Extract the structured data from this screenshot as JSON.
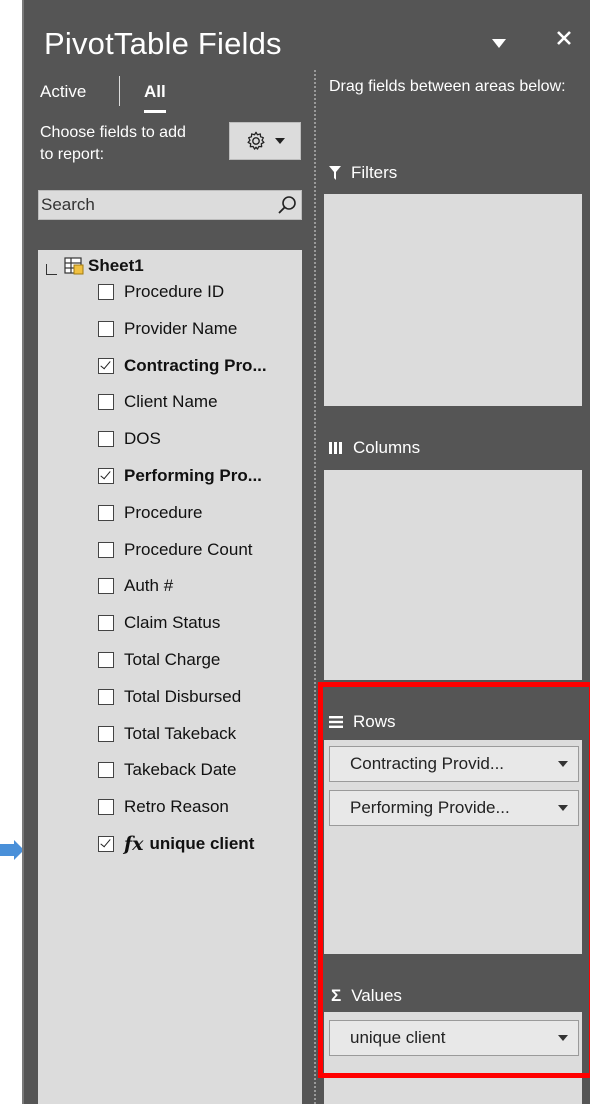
{
  "panel": {
    "title": "PivotTable Fields",
    "tabs": [
      {
        "label": "Active"
      },
      {
        "label": "All"
      }
    ],
    "choose_text": "Choose fields to add to report:",
    "search_placeholder": "Search"
  },
  "field_list": {
    "sheet_name": "Sheet1",
    "fields": [
      {
        "label": "Procedure ID",
        "checked": false
      },
      {
        "label": "Provider Name",
        "checked": false
      },
      {
        "label": "Contracting Pro...",
        "checked": true
      },
      {
        "label": "Client Name",
        "checked": false
      },
      {
        "label": "DOS",
        "checked": false
      },
      {
        "label": "Performing Pro...",
        "checked": true
      },
      {
        "label": "Procedure",
        "checked": false
      },
      {
        "label": "Procedure Count",
        "checked": false
      },
      {
        "label": "Auth #",
        "checked": false
      },
      {
        "label": "Claim Status",
        "checked": false
      },
      {
        "label": "Total Charge",
        "checked": false
      },
      {
        "label": "Total Disbursed",
        "checked": false
      },
      {
        "label": "Total Takeback",
        "checked": false
      },
      {
        "label": "Takeback Date",
        "checked": false
      },
      {
        "label": "Retro Reason",
        "checked": false
      },
      {
        "label": "unique client",
        "checked": true,
        "fx": true,
        "fx_symbol": "fx"
      }
    ]
  },
  "areas": {
    "instruction": "Drag fields between areas below:",
    "filters": {
      "label": "Filters",
      "icon": "filter-icon"
    },
    "columns": {
      "label": "Columns",
      "icon": "columns-icon"
    },
    "rows": {
      "label": "Rows",
      "icon": "rows-icon",
      "items": [
        "Contracting Provid...",
        "Performing Provide..."
      ]
    },
    "values": {
      "label": "Values",
      "icon": "sigma-icon",
      "icon_glyph": "Σ",
      "items": [
        "unique client"
      ]
    }
  },
  "colors": {
    "panel_bg": "#555555",
    "area_bg": "#dcdcdc",
    "highlight": "#ff0000",
    "arrow": "#4a90d9"
  }
}
